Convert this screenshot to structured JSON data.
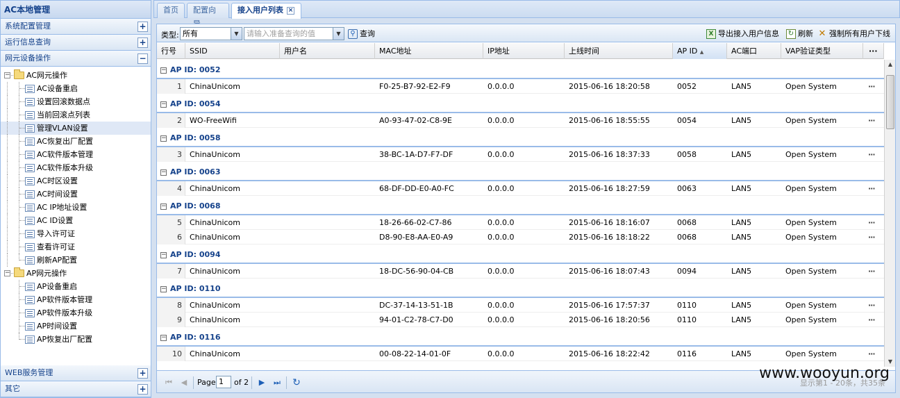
{
  "left_panel": {
    "title": "AC本地管理",
    "sections_top": [
      {
        "label": "系统配置管理",
        "toggle": "+"
      },
      {
        "label": "运行信息查询",
        "toggle": "+"
      },
      {
        "label": "网元设备操作",
        "toggle": "−"
      }
    ],
    "sections_bottom": [
      {
        "label": "WEB服务管理",
        "toggle": "+"
      },
      {
        "label": "其它",
        "toggle": "+"
      }
    ],
    "tree": {
      "ac_group": {
        "label": "AC网元操作",
        "toggle": "−"
      },
      "ac_items": [
        {
          "label": "AC设备重启"
        },
        {
          "label": "设置回滚数据点"
        },
        {
          "label": "当前回滚点列表"
        },
        {
          "label": "管理VLAN设置",
          "selected": true
        },
        {
          "label": "AC恢复出厂配置"
        },
        {
          "label": "AC软件版本管理"
        },
        {
          "label": "AC软件版本升级"
        },
        {
          "label": "AC时区设置"
        },
        {
          "label": "AC时间设置"
        },
        {
          "label": "AC IP地址设置"
        },
        {
          "label": "AC ID设置"
        },
        {
          "label": "导入许可证"
        },
        {
          "label": "查看许可证"
        },
        {
          "label": "刷新AP配置"
        }
      ],
      "ap_group": {
        "label": "AP网元操作",
        "toggle": "−"
      },
      "ap_items": [
        {
          "label": "AP设备重启"
        },
        {
          "label": "AP软件版本管理"
        },
        {
          "label": "AP软件版本升级"
        },
        {
          "label": "AP时间设置"
        },
        {
          "label": "AP恢复出厂配置"
        }
      ]
    }
  },
  "tabs": [
    {
      "label": "首页"
    },
    {
      "label": "配置向导"
    },
    {
      "label": "接入用户列表",
      "active": true,
      "close": "×"
    }
  ],
  "toolbar": {
    "type_label": "类型:",
    "type_value": "所有",
    "search_placeholder": "请输入准备查询的值",
    "search_label": "查询",
    "export_label": "导出接入用户信息",
    "refresh_label": "刷新",
    "kick_all_label": "强制所有用户下线"
  },
  "grid": {
    "columns": {
      "index": "行号",
      "ssid": "SSID",
      "user": "用户名",
      "mac": "MAC地址",
      "ip": "IP地址",
      "time": "上线时间",
      "apid": "AP ID",
      "port": "AC端口",
      "vap": "VAP验证类型",
      "more": "···"
    },
    "sort_indicator": "▲",
    "groups": [
      {
        "title": "AP ID: 0052",
        "toggle": "−",
        "rows": [
          {
            "n": "1",
            "ssid": "ChinaUnicom",
            "user": "",
            "mac": "F0-25-B7-92-E2-F9",
            "ip": "0.0.0.0",
            "time": "2015-06-16 18:20:58",
            "apid": "0052",
            "port": "LAN5",
            "vap": "Open System",
            "more": "···"
          }
        ]
      },
      {
        "title": "AP ID: 0054",
        "toggle": "−",
        "rows": [
          {
            "n": "2",
            "ssid": "WO-FreeWifi",
            "user": "",
            "mac": "A0-93-47-02-C8-9E",
            "ip": "0.0.0.0",
            "time": "2015-06-16 18:55:55",
            "apid": "0054",
            "port": "LAN5",
            "vap": "Open System",
            "more": "···"
          }
        ]
      },
      {
        "title": "AP ID: 0058",
        "toggle": "−",
        "rows": [
          {
            "n": "3",
            "ssid": "ChinaUnicom",
            "user": "",
            "mac": "38-BC-1A-D7-F7-DF",
            "ip": "0.0.0.0",
            "time": "2015-06-16 18:37:33",
            "apid": "0058",
            "port": "LAN5",
            "vap": "Open System",
            "more": "···"
          }
        ]
      },
      {
        "title": "AP ID: 0063",
        "toggle": "−",
        "rows": [
          {
            "n": "4",
            "ssid": "ChinaUnicom",
            "user": "",
            "mac": "68-DF-DD-E0-A0-FC",
            "ip": "0.0.0.0",
            "time": "2015-06-16 18:27:59",
            "apid": "0063",
            "port": "LAN5",
            "vap": "Open System",
            "more": "···"
          }
        ]
      },
      {
        "title": "AP ID: 0068",
        "toggle": "−",
        "rows": [
          {
            "n": "5",
            "ssid": "ChinaUnicom",
            "user": "",
            "mac": "18-26-66-02-C7-86",
            "ip": "0.0.0.0",
            "time": "2015-06-16 18:16:07",
            "apid": "0068",
            "port": "LAN5",
            "vap": "Open System",
            "more": "···"
          },
          {
            "n": "6",
            "ssid": "ChinaUnicom",
            "user": "",
            "mac": "D8-90-E8-AA-E0-A9",
            "ip": "0.0.0.0",
            "time": "2015-06-16 18:18:22",
            "apid": "0068",
            "port": "LAN5",
            "vap": "Open System",
            "more": "···"
          }
        ]
      },
      {
        "title": "AP ID: 0094",
        "toggle": "−",
        "rows": [
          {
            "n": "7",
            "ssid": "ChinaUnicom",
            "user": "",
            "mac": "18-DC-56-90-04-CB",
            "ip": "0.0.0.0",
            "time": "2015-06-16 18:07:43",
            "apid": "0094",
            "port": "LAN5",
            "vap": "Open System",
            "more": "···"
          }
        ]
      },
      {
        "title": "AP ID: 0110",
        "toggle": "−",
        "rows": [
          {
            "n": "8",
            "ssid": "ChinaUnicom",
            "user": "",
            "mac": "DC-37-14-13-51-1B",
            "ip": "0.0.0.0",
            "time": "2015-06-16 17:57:37",
            "apid": "0110",
            "port": "LAN5",
            "vap": "Open System",
            "more": "···"
          },
          {
            "n": "9",
            "ssid": "ChinaUnicom",
            "user": "",
            "mac": "94-01-C2-78-C7-D0",
            "ip": "0.0.0.0",
            "time": "2015-06-16 18:20:56",
            "apid": "0110",
            "port": "LAN5",
            "vap": "Open System",
            "more": "···"
          }
        ]
      },
      {
        "title": "AP ID: 0116",
        "toggle": "−",
        "rows": [
          {
            "n": "10",
            "ssid": "ChinaUnicom",
            "user": "",
            "mac": "00-08-22-14-01-0F",
            "ip": "0.0.0.0",
            "time": "2015-06-16 18:22:42",
            "apid": "0116",
            "port": "LAN5",
            "vap": "Open System",
            "more": "···"
          }
        ]
      }
    ]
  },
  "pager": {
    "page_label": "Page",
    "page_value": "1",
    "of_label": "of 2",
    "status": "显示第1 - 20条，共35条",
    "watermark": "www.wooyun.org"
  },
  "icons": {
    "first": "first-page-icon",
    "prev": "prev-page-icon",
    "next": "next-page-icon",
    "last": "last-page-icon",
    "refresh": "refresh-icon"
  }
}
